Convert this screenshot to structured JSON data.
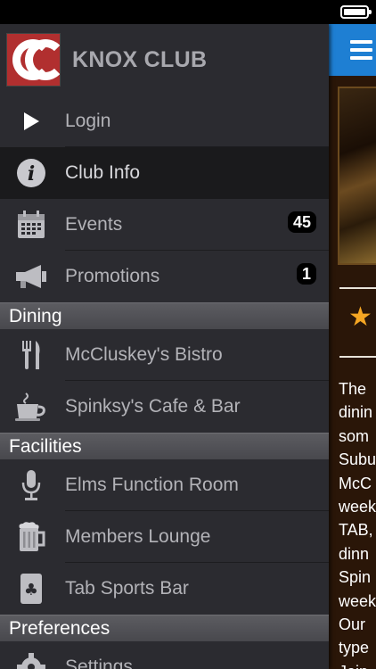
{
  "brand": {
    "title": "KNOX CLUB"
  },
  "menu": {
    "login": {
      "label": "Login"
    },
    "club_info": {
      "label": "Club Info"
    },
    "events": {
      "label": "Events",
      "badge": "45"
    },
    "promotions": {
      "label": "Promotions",
      "badge": "1"
    }
  },
  "sections": {
    "dining": {
      "title": "Dining",
      "items": [
        {
          "label": "McCluskey's Bistro",
          "icon": "fork-knife-icon"
        },
        {
          "label": "Spinksy's Cafe & Bar",
          "icon": "coffee-cup-icon"
        }
      ]
    },
    "facilities": {
      "title": "Facilities",
      "items": [
        {
          "label": "Elms Function Room",
          "icon": "microphone-icon"
        },
        {
          "label": "Members Lounge",
          "icon": "beer-mug-icon"
        },
        {
          "label": "Tab Sports Bar",
          "icon": "playing-card-icon"
        }
      ]
    },
    "preferences": {
      "title": "Preferences",
      "items": [
        {
          "label": "Settings",
          "icon": "gear-icon"
        }
      ]
    }
  },
  "content_text": [
    "The",
    "dinin",
    "som",
    "Subu",
    "McC",
    "week",
    "TAB,",
    "dinn",
    "Spin",
    "week",
    "Our",
    "type",
    "Join"
  ],
  "colors": {
    "header_blue": "#1e7fd3",
    "drawer_bg": "#2b2b30",
    "star": "#f5a623"
  }
}
